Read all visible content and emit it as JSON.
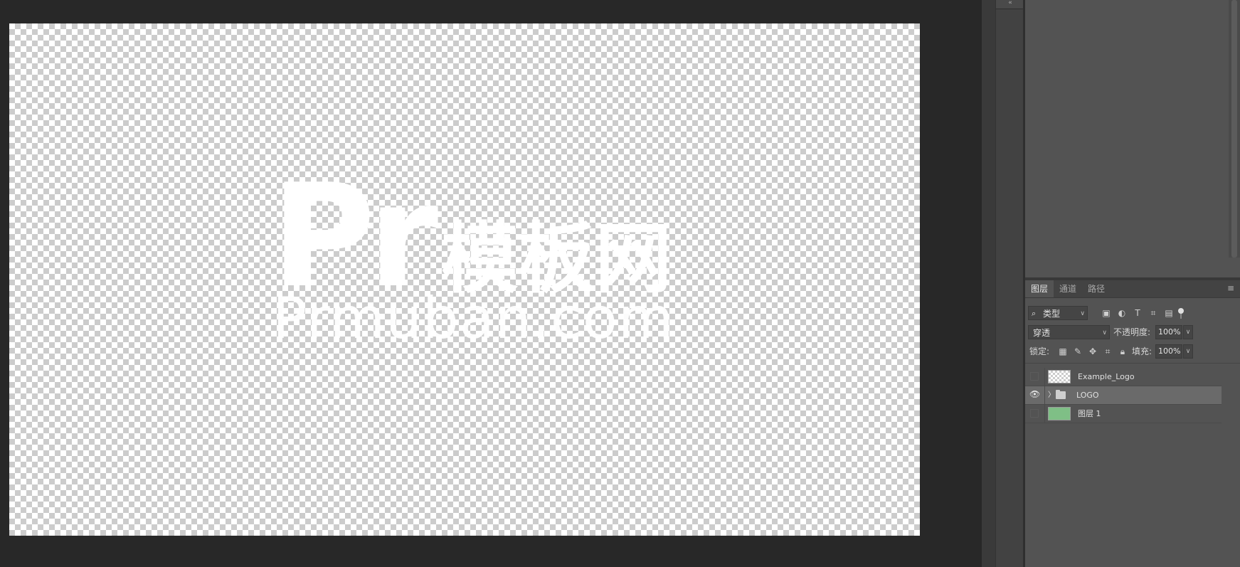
{
  "canvas": {
    "logo_main": "Pr",
    "logo_cn": "模板网",
    "logo_url": "Prmuban.com"
  },
  "layers_panel": {
    "tabs": [
      {
        "label": "图层",
        "active": true
      },
      {
        "label": "通道",
        "active": false
      },
      {
        "label": "路径",
        "active": false
      }
    ],
    "filter": {
      "label": "类型",
      "icons": [
        "image-filter-icon",
        "adjustment-filter-icon",
        "type-filter-icon",
        "shape-filter-icon",
        "smart-object-filter-icon"
      ]
    },
    "blend_mode": "穿透",
    "opacity_label": "不透明度:",
    "opacity_value": "100%",
    "lock_label": "锁定:",
    "fill_label": "填充:",
    "fill_value": "100%",
    "layers": [
      {
        "name": "Example_Logo",
        "visible": false,
        "thumb": "transparent",
        "selected": false
      },
      {
        "name": "LOGO",
        "visible": true,
        "thumb": "folder",
        "selected": true
      },
      {
        "name": "图层 1",
        "visible": false,
        "thumb": "green",
        "selected": false
      }
    ]
  },
  "colors": {
    "workspace": "#282828",
    "panel": "#535353",
    "selected_row": "#6a6a6a",
    "layer1_thumb": "#7fbf86"
  }
}
